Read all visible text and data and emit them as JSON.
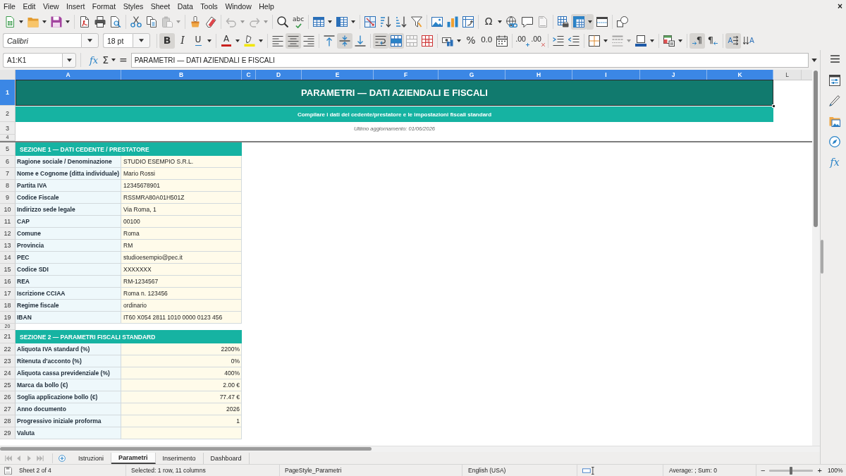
{
  "menu_bar": {
    "items": [
      "File",
      "Edit",
      "View",
      "Insert",
      "Format",
      "Styles",
      "Sheet",
      "Data",
      "Tools",
      "Window",
      "Help"
    ],
    "close_glyph": "×"
  },
  "standard_toolbar": {
    "groups": [
      [
        {
          "kind": "new",
          "pressed": false,
          "disabled": false,
          "dropdown": true
        },
        {
          "kind": "open",
          "pressed": false,
          "disabled": false,
          "dropdown": true
        },
        {
          "kind": "save",
          "pressed": false,
          "disabled": false,
          "dropdown": true
        }
      ],
      [
        {
          "kind": "export_pdf",
          "pressed": false,
          "disabled": false,
          "dropdown": false
        },
        {
          "kind": "print",
          "pressed": false,
          "disabled": false,
          "dropdown": false
        },
        {
          "kind": "print_preview",
          "pressed": false,
          "disabled": false,
          "dropdown": false
        }
      ],
      [
        {
          "kind": "cut",
          "pressed": false,
          "disabled": false,
          "dropdown": false
        },
        {
          "kind": "copy",
          "pressed": false,
          "disabled": false,
          "dropdown": false
        },
        {
          "kind": "paste",
          "pressed": false,
          "disabled": true,
          "dropdown": true
        }
      ],
      [
        {
          "kind": "clone_formatting",
          "pressed": false,
          "disabled": false,
          "dropdown": false
        },
        {
          "kind": "clear_formatting",
          "pressed": false,
          "disabled": false,
          "dropdown": false
        }
      ],
      [
        {
          "kind": "undo",
          "pressed": false,
          "disabled": true,
          "dropdown": true
        },
        {
          "kind": "redo",
          "pressed": false,
          "disabled": true,
          "dropdown": true
        }
      ],
      [
        {
          "kind": "find_replace",
          "pressed": false,
          "disabled": false,
          "dropdown": false
        },
        {
          "kind": "spelling",
          "glyph": "abc",
          "pressed": false,
          "disabled": false,
          "dropdown": false
        }
      ],
      [
        {
          "kind": "rows",
          "pressed": false,
          "disabled": false,
          "dropdown": true
        },
        {
          "kind": "columns",
          "pressed": false,
          "disabled": false,
          "dropdown": true
        }
      ],
      [
        {
          "kind": "sort",
          "pressed": false,
          "disabled": false,
          "dropdown": false
        },
        {
          "kind": "sort_ascending",
          "pressed": false,
          "disabled": false,
          "dropdown": false
        },
        {
          "kind": "sort_descending",
          "pressed": false,
          "disabled": false,
          "dropdown": false
        },
        {
          "kind": "autofilter",
          "pressed": false,
          "disabled": false,
          "dropdown": false
        }
      ],
      [
        {
          "kind": "image",
          "pressed": false,
          "disabled": false,
          "dropdown": false
        },
        {
          "kind": "chart",
          "pressed": false,
          "disabled": false,
          "dropdown": false
        },
        {
          "kind": "pivot_table",
          "pressed": false,
          "disabled": false,
          "dropdown": false
        }
      ],
      [
        {
          "kind": "special_character",
          "glyph": "Ω",
          "pressed": false,
          "disabled": false,
          "dropdown": true
        },
        {
          "kind": "hyperlink",
          "pressed": false,
          "disabled": false,
          "dropdown": false
        },
        {
          "kind": "comment",
          "pressed": false,
          "disabled": false,
          "dropdown": false
        },
        {
          "kind": "headers_footers",
          "pressed": false,
          "disabled": true,
          "dropdown": false
        }
      ],
      [
        {
          "kind": "print_area",
          "pressed": false,
          "disabled": false,
          "dropdown": false
        },
        {
          "kind": "freeze",
          "pressed": true,
          "disabled": false,
          "dropdown": true
        },
        {
          "kind": "split_window",
          "pressed": false,
          "disabled": false,
          "dropdown": false
        }
      ],
      [
        {
          "kind": "draw_functions",
          "pressed": false,
          "disabled": false,
          "dropdown": false
        }
      ]
    ]
  },
  "formatting_toolbar": {
    "font_name": "Calibri",
    "font_size": "18 pt",
    "groups": [
      [
        {
          "kind": "bold",
          "glyph": "B",
          "pressed": true,
          "disabled": false,
          "dropdown": false
        },
        {
          "kind": "italic",
          "glyph": "I",
          "pressed": false,
          "disabled": false,
          "dropdown": false
        },
        {
          "kind": "underline",
          "glyph": "U",
          "pressed": false,
          "disabled": false,
          "dropdown": true
        }
      ],
      [
        {
          "kind": "font_color",
          "glyph": "A",
          "pressed": false,
          "disabled": false,
          "dropdown": true
        },
        {
          "kind": "highlight",
          "pressed": false,
          "disabled": false,
          "dropdown": true
        }
      ],
      [
        {
          "kind": "align_left",
          "pressed": false,
          "disabled": false,
          "dropdown": false
        },
        {
          "kind": "align_center",
          "pressed": true,
          "disabled": false,
          "dropdown": false
        },
        {
          "kind": "align_right",
          "pressed": false,
          "disabled": false,
          "dropdown": false
        }
      ],
      [
        {
          "kind": "align_top",
          "pressed": false,
          "disabled": false,
          "dropdown": false
        },
        {
          "kind": "align_middle",
          "pressed": true,
          "disabled": false,
          "dropdown": false
        },
        {
          "kind": "align_bottom",
          "pressed": false,
          "disabled": false,
          "dropdown": false
        }
      ],
      [
        {
          "kind": "wrap_text",
          "pressed": true,
          "disabled": false,
          "dropdown": false
        },
        {
          "kind": "merge_center",
          "pressed": true,
          "disabled": false,
          "dropdown": false
        },
        {
          "kind": "merge_cells",
          "pressed": false,
          "disabled": true,
          "dropdown": false
        },
        {
          "kind": "unmerge_cells",
          "pressed": false,
          "disabled": false,
          "dropdown": false
        }
      ],
      [
        {
          "kind": "currency",
          "pressed": false,
          "disabled": false,
          "dropdown": true
        },
        {
          "kind": "percent",
          "glyph": "%",
          "pressed": false,
          "disabled": false,
          "dropdown": false
        },
        {
          "kind": "number",
          "glyph": "0.0",
          "pressed": false,
          "disabled": false,
          "dropdown": false
        },
        {
          "kind": "date",
          "pressed": false,
          "disabled": false,
          "dropdown": false
        }
      ],
      [
        {
          "kind": "add_decimal",
          "glyph": ".00",
          "pressed": false,
          "disabled": false,
          "dropdown": false
        },
        {
          "kind": "delete_decimal",
          "glyph": ".00",
          "pressed": false,
          "disabled": false,
          "dropdown": false
        }
      ],
      [
        {
          "kind": "indent_increase",
          "pressed": false,
          "disabled": false,
          "dropdown": false
        },
        {
          "kind": "indent_decrease",
          "pressed": false,
          "disabled": false,
          "dropdown": false
        }
      ],
      [
        {
          "kind": "borders",
          "pressed": false,
          "disabled": false,
          "dropdown": true
        },
        {
          "kind": "border_style",
          "pressed": false,
          "disabled": true,
          "dropdown": true
        },
        {
          "kind": "border_color",
          "pressed": false,
          "disabled": false,
          "dropdown": true
        }
      ],
      [
        {
          "kind": "conditional",
          "pressed": false,
          "disabled": false,
          "dropdown": true
        }
      ],
      [
        {
          "kind": "paragraph_ltr",
          "glyph": "¶",
          "pressed": true,
          "disabled": false,
          "dropdown": false
        },
        {
          "kind": "paragraph_rtl",
          "glyph": "¶",
          "pressed": false,
          "disabled": false,
          "dropdown": false
        }
      ],
      [
        {
          "kind": "text_ltr",
          "glyph": "A",
          "pressed": true,
          "disabled": false,
          "dropdown": false
        },
        {
          "kind": "text_ttb",
          "glyph": "A",
          "pressed": false,
          "disabled": false,
          "dropdown": false
        }
      ]
    ]
  },
  "formula_bar": {
    "name_box": "A1:K1",
    "buttons": [
      {
        "kind": "function_wizard",
        "glyph": "fx",
        "dropdown": false
      },
      {
        "kind": "sum",
        "glyph": "Σ",
        "dropdown": true
      },
      {
        "kind": "formula",
        "glyph": "=",
        "dropdown": false
      }
    ],
    "value": "PARAMETRI — DATI AZIENDALI E FISCALI"
  },
  "sheet": {
    "columns": [
      {
        "letter": "A",
        "selected": true
      },
      {
        "letter": "B",
        "selected": true
      },
      {
        "letter": "C",
        "selected": true
      },
      {
        "letter": "D",
        "selected": true
      },
      {
        "letter": "E",
        "selected": true
      },
      {
        "letter": "F",
        "selected": true
      },
      {
        "letter": "G",
        "selected": true
      },
      {
        "letter": "H",
        "selected": true
      },
      {
        "letter": "I",
        "selected": true
      },
      {
        "letter": "J",
        "selected": true
      },
      {
        "letter": "K",
        "selected": true
      },
      {
        "letter": "L",
        "selected": false
      }
    ],
    "frozen_rows": [
      {
        "number": "1",
        "kind": "title",
        "selected": true,
        "text": "PARAMETRI — DATI AZIENDALI E FISCALI"
      },
      {
        "number": "2",
        "kind": "subtitle",
        "selected": false,
        "text": "Compilare i dati del cedente/prestatore e le impostazioni fiscali standard"
      },
      {
        "number": "3",
        "kind": "note",
        "selected": false,
        "text": "Ultimo aggiornamento: 01/06/2026"
      },
      {
        "number": "4",
        "kind": "blank",
        "selected": false
      }
    ],
    "rows": [
      {
        "number": "5",
        "kind": "section",
        "selected": false,
        "text": "SEZIONE 1 — DATI CEDENTE / PRESTATORE"
      },
      {
        "number": "6",
        "kind": "field",
        "selected": false,
        "label": "Ragione sociale / Denominazione",
        "value": "STUDIO ESEMPIO S.R.L."
      },
      {
        "number": "7",
        "kind": "field",
        "selected": false,
        "label": "Nome e Cognome (ditta individuale)",
        "value": "Mario Rossi"
      },
      {
        "number": "8",
        "kind": "field",
        "selected": false,
        "label": "Partita IVA",
        "value": "12345678901"
      },
      {
        "number": "9",
        "kind": "field",
        "selected": false,
        "label": "Codice Fiscale",
        "value": "RSSMRA80A01H501Z"
      },
      {
        "number": "10",
        "kind": "field",
        "selected": false,
        "label": "Indirizzo sede legale",
        "value": "Via Roma, 1"
      },
      {
        "number": "11",
        "kind": "field",
        "selected": false,
        "label": "CAP",
        "value": "00100"
      },
      {
        "number": "12",
        "kind": "field",
        "selected": false,
        "label": "Comune",
        "value": "Roma"
      },
      {
        "number": "13",
        "kind": "field",
        "selected": false,
        "label": "Provincia",
        "value": "RM"
      },
      {
        "number": "14",
        "kind": "field",
        "selected": false,
        "label": "PEC",
        "value": "studioesempio@pec.it"
      },
      {
        "number": "15",
        "kind": "field",
        "selected": false,
        "label": "Codice SDI",
        "value": "XXXXXXX"
      },
      {
        "number": "16",
        "kind": "field",
        "selected": false,
        "label": "REA",
        "value": "RM-1234567"
      },
      {
        "number": "17",
        "kind": "field",
        "selected": false,
        "label": "Iscrizione CCIAA",
        "value": "Roma n. 123456"
      },
      {
        "number": "18",
        "kind": "field",
        "selected": false,
        "label": "Regime fiscale",
        "value": "ordinario"
      },
      {
        "number": "19",
        "kind": "field",
        "selected": false,
        "label": "IBAN",
        "value": "IT60 X054 2811 1010 0000 0123 456"
      },
      {
        "number": "20",
        "kind": "blank",
        "selected": false
      },
      {
        "number": "21",
        "kind": "section",
        "selected": false,
        "text": "SEZIONE 2 — PARAMETRI FISCALI STANDARD"
      },
      {
        "number": "22",
        "kind": "number",
        "selected": false,
        "label": "Aliquota IVA standard (%)",
        "value": "2200%"
      },
      {
        "number": "23",
        "kind": "number",
        "selected": false,
        "label": "Ritenuta d'acconto (%)",
        "value": "0%"
      },
      {
        "number": "24",
        "kind": "number",
        "selected": false,
        "label": "Aliquota cassa previdenziale (%)",
        "value": "400%"
      },
      {
        "number": "25",
        "kind": "number",
        "selected": false,
        "label": "Marca da bollo (€)",
        "value": "2.00 €"
      },
      {
        "number": "26",
        "kind": "number",
        "selected": false,
        "label": "Soglia applicazione bollo (€)",
        "value": "77.47 €"
      },
      {
        "number": "27",
        "kind": "number",
        "selected": false,
        "label": "Anno documento",
        "value": "2026"
      },
      {
        "number": "28",
        "kind": "number",
        "selected": false,
        "label": "Progressivo iniziale proforma",
        "value": "1"
      },
      {
        "number": "29",
        "kind": "number",
        "selected": false,
        "label": "Valuta"
      }
    ]
  },
  "sheet_tabs": {
    "navigation": [
      {
        "kind": "first",
        "disabled": true
      },
      {
        "kind": "previous",
        "disabled": true
      },
      {
        "kind": "next",
        "disabled": true
      },
      {
        "kind": "last",
        "disabled": true
      }
    ],
    "tabs": [
      {
        "label": "Istruzioni",
        "selected": false
      },
      {
        "label": "Parametri",
        "selected": true
      },
      {
        "label": "Inserimento",
        "selected": false
      },
      {
        "label": "Dashboard",
        "selected": false
      }
    ]
  },
  "sidebar": {
    "buttons": [
      {
        "kind": "properties"
      },
      {
        "kind": "styles"
      },
      {
        "kind": "gallery"
      },
      {
        "kind": "navigator"
      },
      {
        "kind": "functions",
        "glyph": "fx"
      }
    ]
  },
  "status_bar": {
    "sheet_info": "Sheet 2 of 4",
    "selection": "Selected: 1 row, 11 columns",
    "page_style": "PageStyle_Parametri",
    "language": "English (USA)",
    "summary": "Average: ; Sum: 0",
    "zoom": {
      "out_glyph": "−",
      "in_glyph": "+",
      "level": 0.5,
      "percent": "100%"
    }
  }
}
